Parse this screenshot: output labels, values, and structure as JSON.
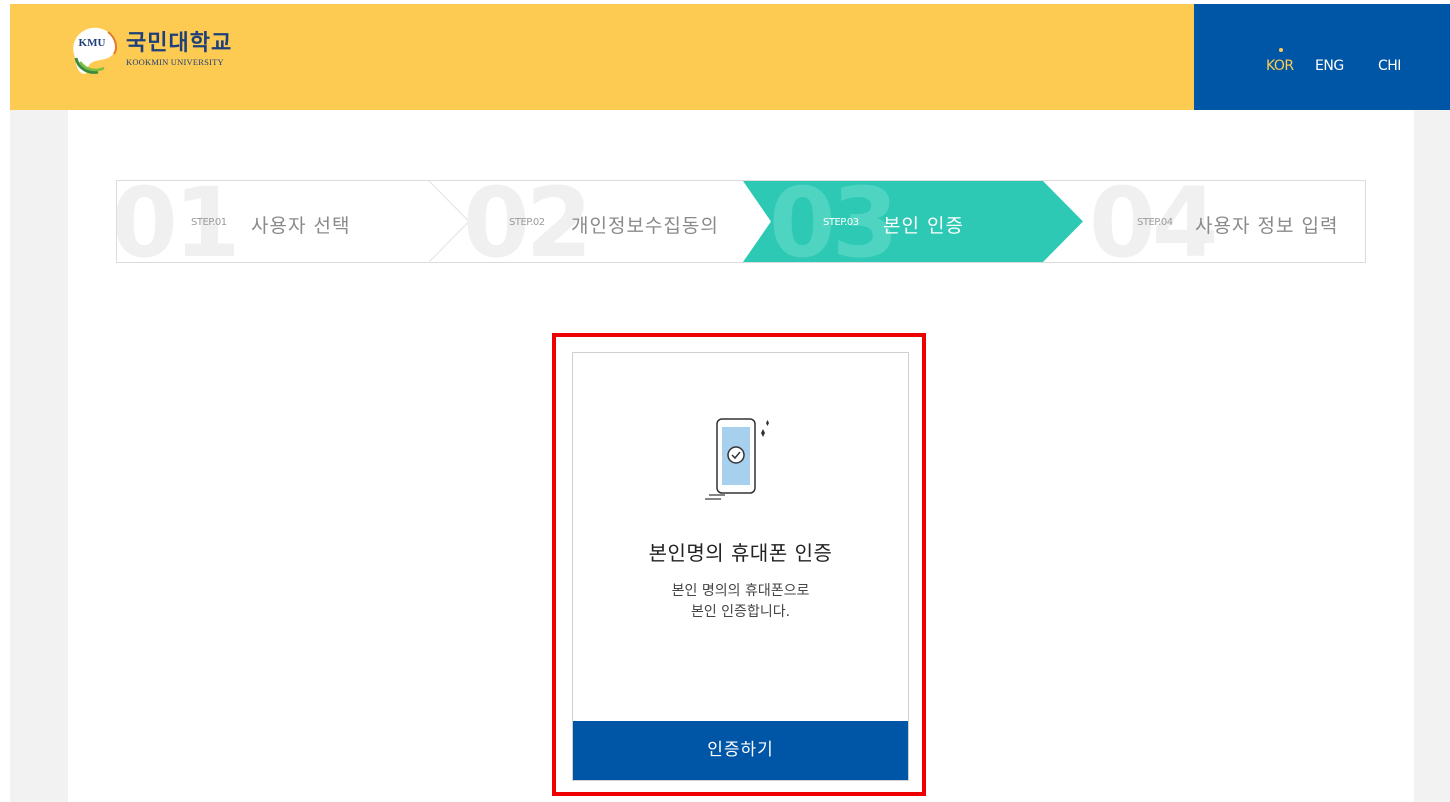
{
  "header": {
    "logo_emblem_text": "KMU",
    "logo_name_kr": "국민대학교",
    "logo_name_en": "KOOKMIN UNIVERSITY",
    "colors": {
      "header_bg": "#fdcb52",
      "lang_bg": "#0056a6",
      "active_lang": "#fdcb52"
    }
  },
  "languages": [
    {
      "label": "KOR",
      "active": true
    },
    {
      "label": "ENG",
      "active": false
    },
    {
      "label": "CHI",
      "active": false
    }
  ],
  "steps": [
    {
      "number": "01",
      "small": "STEP.01",
      "title": "사용자 선택",
      "active": false
    },
    {
      "number": "02",
      "small": "STEP.02",
      "title": "개인정보수집동의",
      "active": false
    },
    {
      "number": "03",
      "small": "STEP.03",
      "title": "본인 인증",
      "active": true
    },
    {
      "number": "04",
      "small": "STEP.04",
      "title": "사용자 정보 입력",
      "active": false
    }
  ],
  "step_colors": {
    "active": "#2ec9b4"
  },
  "auth_card": {
    "icon": "phone-check-icon",
    "title": "본인명의 휴대폰 인증",
    "desc_line1": "본인 명의의 휴대폰으로",
    "desc_line2": "본인 인증합니다.",
    "button_label": "인증하기",
    "highlight_color": "#ee0000"
  }
}
